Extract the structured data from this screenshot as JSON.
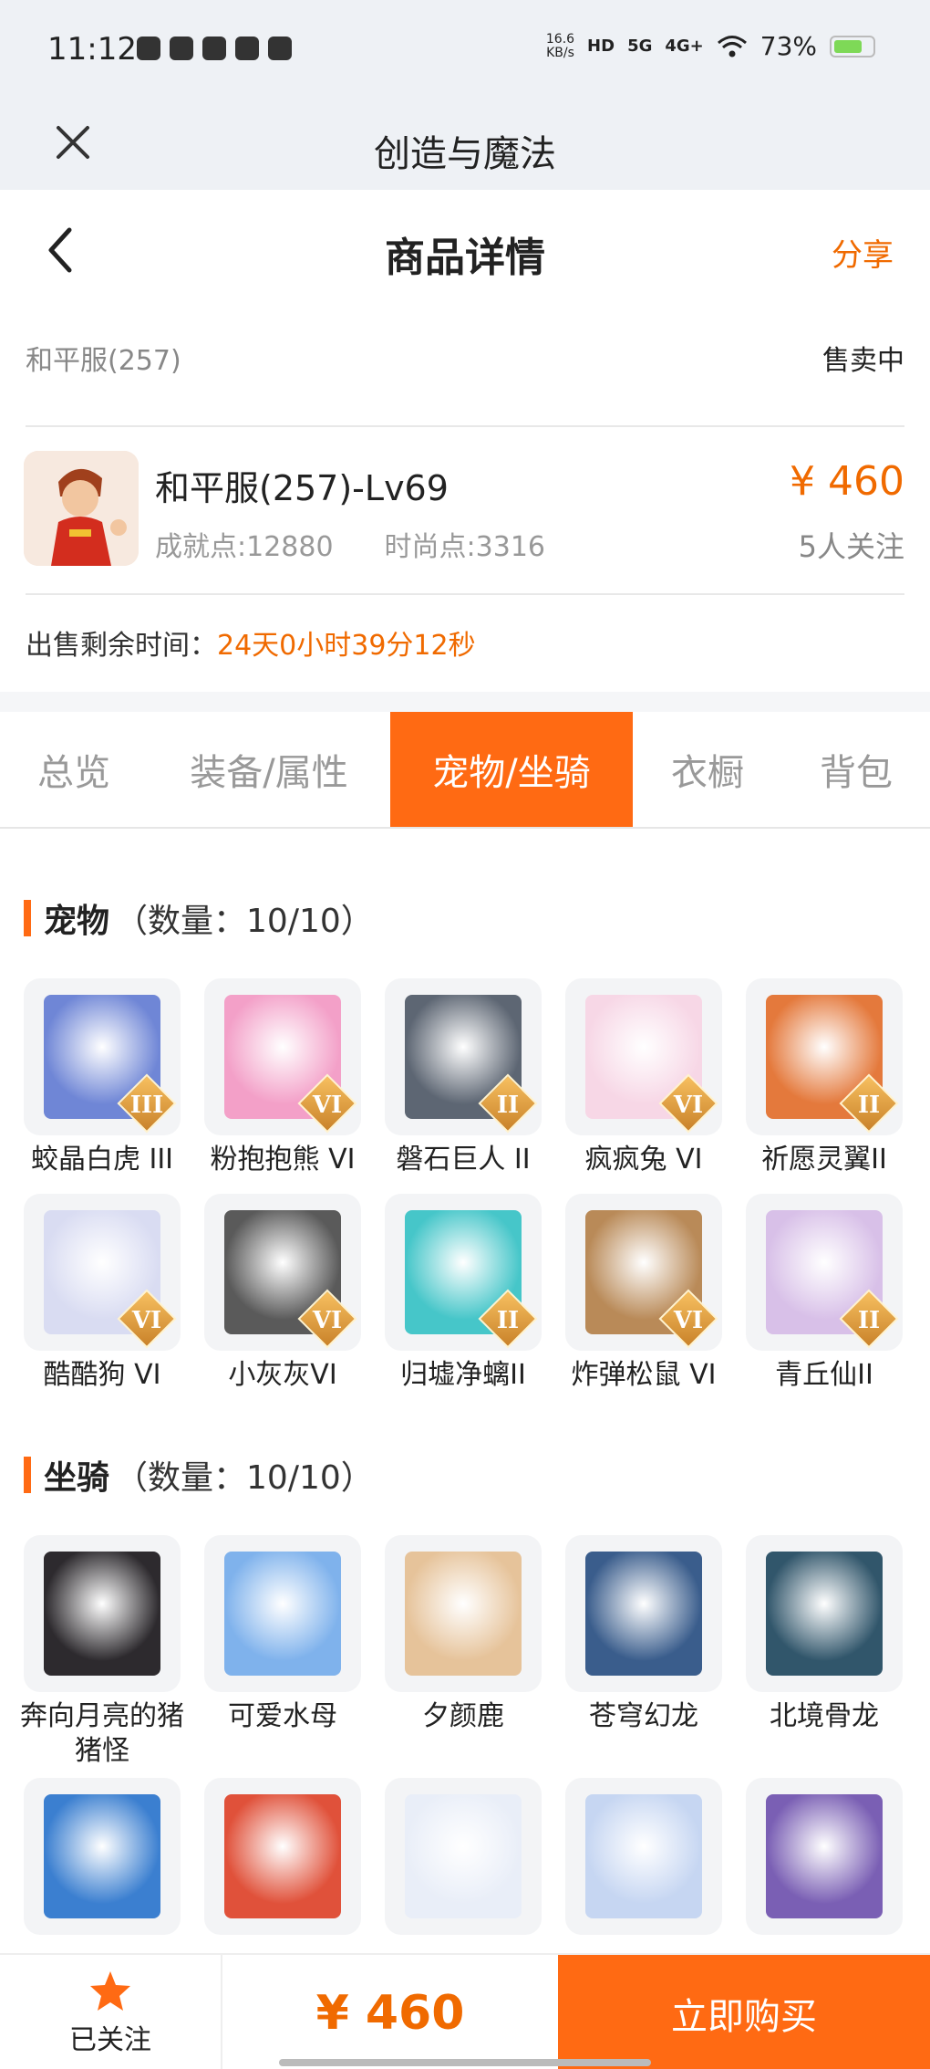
{
  "status_bar": {
    "time": "11:12",
    "net_speed_value": "16.6",
    "net_speed_unit": "KB/s",
    "hd": "HD",
    "net1": "5G",
    "net2": "4G+",
    "battery": "73%"
  },
  "app_bar": {
    "title": "创造与魔法"
  },
  "header": {
    "title": "商品详情",
    "share": "分享"
  },
  "server": {
    "name": "和平服(257)",
    "status": "售卖中"
  },
  "product": {
    "title": "和平服(257)-Lv69",
    "achievement": "成就点:12880",
    "fashion": "时尚点:3316",
    "price": "¥ 460",
    "followers": "5人关注"
  },
  "remaining": {
    "label": "出售剩余时间：",
    "value": "24天0小时39分12秒"
  },
  "tabs": [
    "总览",
    "装备/属性",
    "宠物/坐骑",
    "衣橱",
    "背包"
  ],
  "pets": {
    "title": "宠物",
    "count": "（数量：10/10）",
    "items": [
      {
        "name": "蛟晶白虎 III",
        "badge": "III",
        "color": "#6f86d6"
      },
      {
        "name": "粉抱抱熊 VI",
        "badge": "VI",
        "color": "#f3a0c8"
      },
      {
        "name": "磐石巨人 II",
        "badge": "II",
        "color": "#5d6673"
      },
      {
        "name": "疯疯兔 VI",
        "badge": "VI",
        "color": "#f7d7e6"
      },
      {
        "name": "祈愿灵翼II",
        "badge": "II",
        "color": "#e4793c"
      },
      {
        "name": "酷酷狗 VI",
        "badge": "VI",
        "color": "#d9dcf2"
      },
      {
        "name": "小灰灰VI",
        "badge": "VI",
        "color": "#5a5a5a"
      },
      {
        "name": "归墟净螭II",
        "badge": "II",
        "color": "#46c6c9"
      },
      {
        "name": "炸弹松鼠 VI",
        "badge": "VI",
        "color": "#b98a58"
      },
      {
        "name": "青丘仙II",
        "badge": "II",
        "color": "#d8c0e8"
      }
    ]
  },
  "mounts": {
    "title": "坐骑",
    "count": "（数量：10/10）",
    "items": [
      {
        "name": "奔向月亮的猪猪怪",
        "color": "#2d2a2e"
      },
      {
        "name": "可爱水母",
        "color": "#7fb2ec"
      },
      {
        "name": "夕颜鹿",
        "color": "#e6c39a"
      },
      {
        "name": "苍穹幻龙",
        "color": "#3a5d8c"
      },
      {
        "name": "北境骨龙",
        "color": "#31566b"
      },
      {
        "name": "",
        "color": "#3b7fd0"
      },
      {
        "name": "",
        "color": "#e0513a"
      },
      {
        "name": "",
        "color": "#e9eef8"
      },
      {
        "name": "",
        "color": "#c6d6f2"
      },
      {
        "name": "",
        "color": "#7a5fb4"
      }
    ]
  },
  "bottom": {
    "follow": "已关注",
    "price": "¥ 460",
    "buy": "立即购买"
  }
}
